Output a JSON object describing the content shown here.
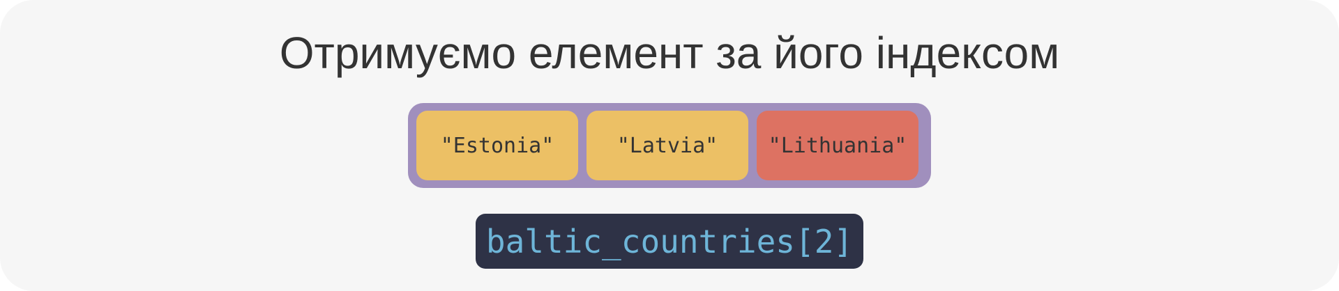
{
  "title": "Отримуємо елемент за його індексом",
  "array": {
    "items": [
      {
        "label": "\"Estonia\"",
        "state": "normal"
      },
      {
        "label": "\"Latvia\"",
        "state": "normal"
      },
      {
        "label": "\"Lithuania\"",
        "state": "selected"
      }
    ]
  },
  "code": {
    "expression": "baltic_countries[2]"
  },
  "colors": {
    "background": "#f6f6f6",
    "array_border": "#a08fbd",
    "cell_normal": "#ecc065",
    "cell_selected": "#dd7262",
    "code_background": "#2e3246",
    "code_text": "#6eb5d8",
    "text": "#333333"
  }
}
